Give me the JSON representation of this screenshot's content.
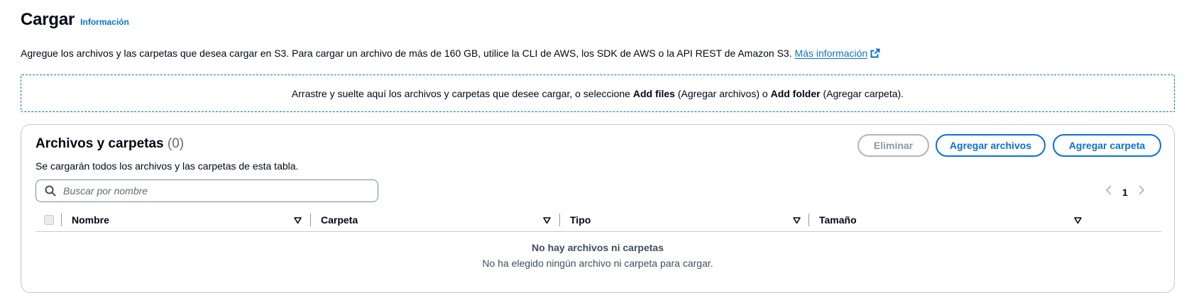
{
  "header": {
    "title": "Cargar",
    "info_link": "Información"
  },
  "description": {
    "text": "Agregue los archivos y las carpetas que desea cargar en S3. Para cargar un archivo de más de 160 GB, utilice la CLI de AWS, los SDK de AWS o la API REST de Amazon S3.",
    "more_link": "Más información"
  },
  "dropzone": {
    "part1": "Arrastre y suelte aquí los archivos y carpetas que desee cargar, o seleccione ",
    "add_files": "Add files",
    "part2": " (Agregar archivos) o ",
    "add_folder": "Add folder",
    "part3": " (Agregar carpeta)."
  },
  "panel": {
    "title": "Archivos y carpetas",
    "count": "(0)",
    "description": "Se cargarán todos los archivos y las carpetas de esta tabla.",
    "buttons": {
      "delete": "Eliminar",
      "add_files": "Agregar archivos",
      "add_folder": "Agregar carpeta"
    },
    "search": {
      "placeholder": "Buscar por nombre",
      "value": ""
    },
    "pagination": {
      "current_page": "1"
    },
    "columns": [
      "Nombre",
      "Carpeta",
      "Tipo",
      "Tamaño"
    ],
    "empty": {
      "title": "No hay archivos ni carpetas",
      "description": "No ha elegido ningún archivo ni carpeta para cargar."
    }
  },
  "colors": {
    "accent": "#0972d3",
    "text": "#000716",
    "disabled": "#8d99a8",
    "border": "#c6c6cd"
  },
  "icons": [
    "external-link-icon",
    "search-icon",
    "chevron-left-icon",
    "chevron-right-icon",
    "sort-icon"
  ]
}
